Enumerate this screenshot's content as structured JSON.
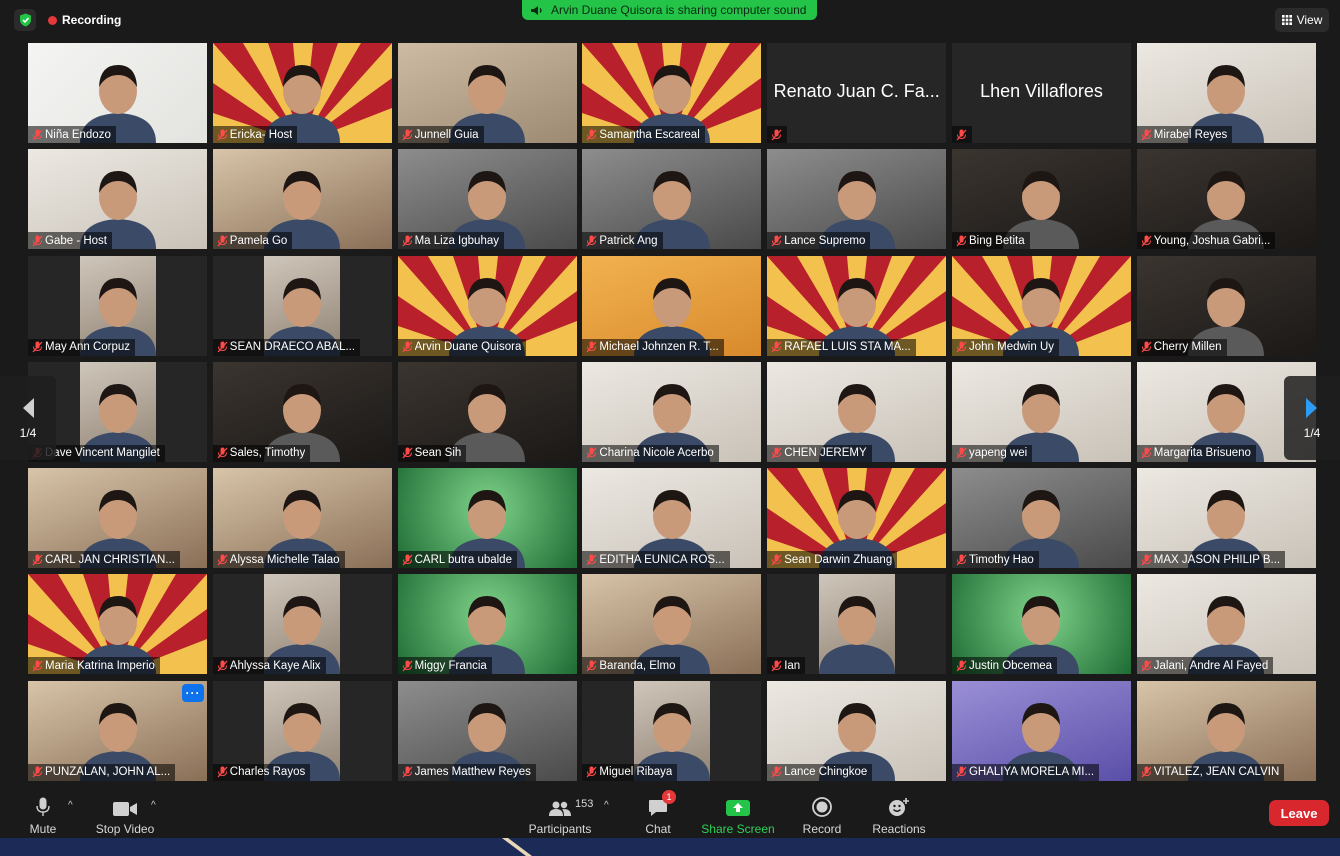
{
  "top": {
    "recording_label": "Recording",
    "share_banner": "Arvin Duane Quisora is sharing computer sound",
    "view_label": "View"
  },
  "pagination": {
    "left": "1/4",
    "right": "1/4"
  },
  "participants": [
    {
      "name": "Niña Endozo",
      "style": "white"
    },
    {
      "name": "Ericka- Host",
      "style": "rays"
    },
    {
      "name": "Junnell Guia",
      "style": "beige",
      "active": true
    },
    {
      "name": "Samantha Escareal",
      "style": "rays"
    },
    {
      "name": "Renato Juan C. Fa...",
      "style": "noVideo"
    },
    {
      "name": "Lhen Villaflores",
      "style": "noVideo"
    },
    {
      "name": "Mirabel Reyes",
      "style": "light"
    },
    {
      "name": "Gabe - Host",
      "style": "light"
    },
    {
      "name": "Pamela Go",
      "style": "warm"
    },
    {
      "name": "Ma Liza Igbuhay",
      "style": "gray"
    },
    {
      "name": "Patrick Ang",
      "style": "gray"
    },
    {
      "name": "Lance Supremo",
      "style": "gray"
    },
    {
      "name": "Bing Betita",
      "style": "dark"
    },
    {
      "name": "Young, Joshua Gabri...",
      "style": "dark"
    },
    {
      "name": "May Ann Corpuz",
      "style": "pillar"
    },
    {
      "name": "SEAN DRAECO ABAL...",
      "style": "pillar"
    },
    {
      "name": "Arvin Duane Quisora",
      "style": "rays"
    },
    {
      "name": "Michael Johnzen R. T...",
      "style": "orange"
    },
    {
      "name": "RAFAEL LUIS STA MA...",
      "style": "rays"
    },
    {
      "name": "John Medwin Uy",
      "style": "rays"
    },
    {
      "name": "Cherry Millen",
      "style": "dark"
    },
    {
      "name": "Dave Vincent Mangilet",
      "style": "pillar"
    },
    {
      "name": "Sales, Timothy",
      "style": "dark"
    },
    {
      "name": "Sean Sih",
      "style": "dark"
    },
    {
      "name": "Charina Nicole Acerbo",
      "style": "light"
    },
    {
      "name": "CHEN JEREMY",
      "style": "light"
    },
    {
      "name": "yapeng  wei",
      "style": "light"
    },
    {
      "name": "Margarita Brisueno",
      "style": "light"
    },
    {
      "name": "CARL JAN CHRISTIAN...",
      "style": "warm"
    },
    {
      "name": "Alyssa Michelle Talao",
      "style": "warm"
    },
    {
      "name": "CARL butra ubalde",
      "style": "green"
    },
    {
      "name": "EDITHA EUNICA ROS...",
      "style": "light"
    },
    {
      "name": "Sean Darwin Zhuang",
      "style": "rays"
    },
    {
      "name": "Timothy Hao",
      "style": "gray"
    },
    {
      "name": "MAX JASON PHILIP B...",
      "style": "light"
    },
    {
      "name": "Maria Katrina Imperio",
      "style": "rays"
    },
    {
      "name": "Ahlyssa Kaye Alix",
      "style": "pillar"
    },
    {
      "name": "Miggy Francia",
      "style": "green"
    },
    {
      "name": "Baranda, Elmo",
      "style": "warm"
    },
    {
      "name": "Ian",
      "style": "pillar"
    },
    {
      "name": "Justin Obcemea",
      "style": "green"
    },
    {
      "name": "Jalani, Andre Al Fayed",
      "style": "light"
    },
    {
      "name": "PUNZALAN, JOHN AL...",
      "style": "warm",
      "more": true
    },
    {
      "name": "Charles Rayos",
      "style": "pillar"
    },
    {
      "name": "James Matthew Reyes",
      "style": "gray"
    },
    {
      "name": "Miguel Ribaya",
      "style": "pillar"
    },
    {
      "name": "Lance Chingkoe",
      "style": "light"
    },
    {
      "name": "GHALIYA MORELA MI...",
      "style": "purple"
    },
    {
      "name": "VITALEZ, JEAN CALVIN",
      "style": "warm"
    }
  ],
  "toolbar": {
    "mute": "Mute",
    "stop_video": "Stop Video",
    "participants": "Participants",
    "participants_count": "153",
    "chat": "Chat",
    "chat_badge": "1",
    "share_screen": "Share Screen",
    "record": "Record",
    "reactions": "Reactions",
    "leave": "Leave"
  }
}
